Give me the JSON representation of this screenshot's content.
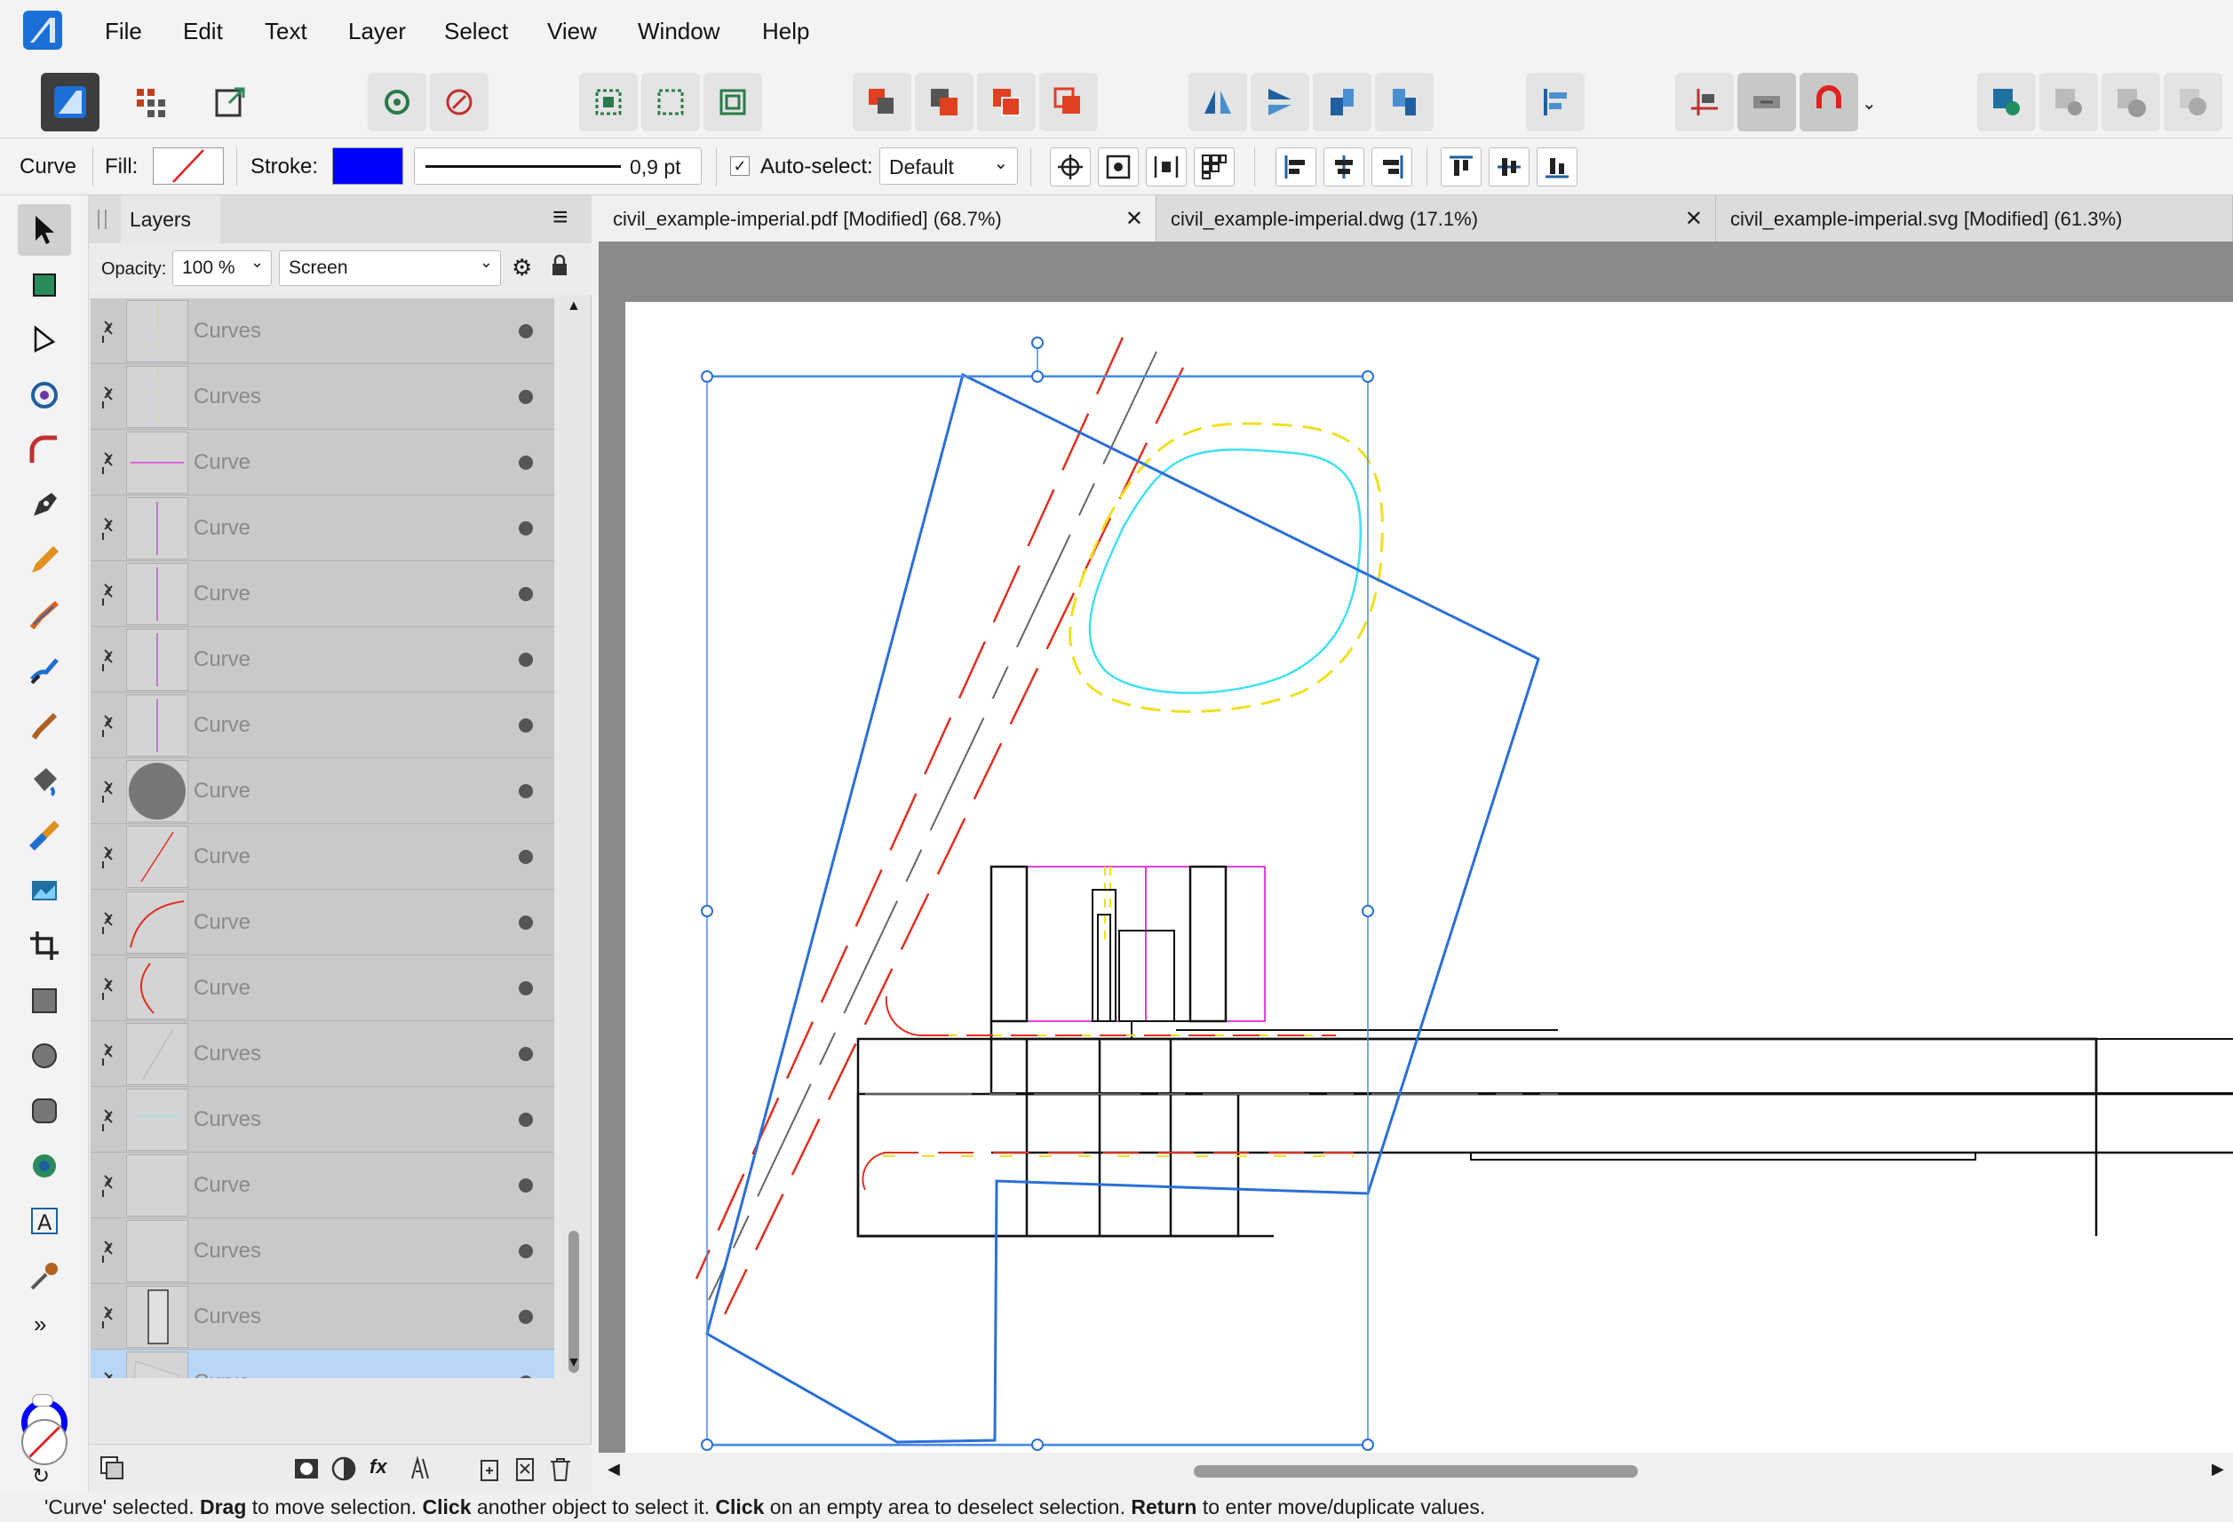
{
  "menu": [
    "File",
    "Edit",
    "Text",
    "Layer",
    "Select",
    "View",
    "Window",
    "Help"
  ],
  "context": {
    "object_type": "Curve",
    "fill_label": "Fill:",
    "stroke_label": "Stroke:",
    "stroke_color": "#0000ff",
    "stroke_width": "0,9 pt",
    "autoselect_label": "Auto-select:",
    "autoselect_value": "Default"
  },
  "layers_panel": {
    "title": "Layers",
    "opacity_label": "Opacity:",
    "opacity_value": "100 %",
    "blend_mode": "Screen",
    "rows": [
      {
        "name": "Curves",
        "thumb": "faint-v",
        "selected": false
      },
      {
        "name": "Curves",
        "thumb": "faint-v",
        "selected": false
      },
      {
        "name": "Curve",
        "thumb": "magenta-h",
        "selected": false
      },
      {
        "name": "Curve",
        "thumb": "purple-v",
        "selected": false
      },
      {
        "name": "Curve",
        "thumb": "purple-v",
        "selected": false
      },
      {
        "name": "Curve",
        "thumb": "purple-v",
        "selected": false
      },
      {
        "name": "Curve",
        "thumb": "purple-v",
        "selected": false
      },
      {
        "name": "Curve",
        "thumb": "gray-circle",
        "selected": false
      },
      {
        "name": "Curve",
        "thumb": "red-diagonal",
        "selected": false
      },
      {
        "name": "Curve",
        "thumb": "red-arc",
        "selected": false
      },
      {
        "name": "Curve",
        "thumb": "red-arc-left",
        "selected": false
      },
      {
        "name": "Curves",
        "thumb": "faint-diag",
        "selected": false
      },
      {
        "name": "Curves",
        "thumb": "faint-cyan",
        "selected": false
      },
      {
        "name": "Curve",
        "thumb": "blank",
        "selected": false
      },
      {
        "name": "Curves",
        "thumb": "blank",
        "selected": false
      },
      {
        "name": "Curves",
        "thumb": "rect",
        "selected": false
      },
      {
        "name": "Curve",
        "thumb": "poly",
        "selected": true
      }
    ]
  },
  "tabs": [
    {
      "label": "civil_example-imperial.pdf [Modified] (68.7%)",
      "active": true,
      "closable": true
    },
    {
      "label": "civil_example-imperial.dwg (17.1%)",
      "active": false,
      "closable": true
    },
    {
      "label": "civil_example-imperial.svg [Modified] (61.3%)",
      "active": false,
      "closable": false
    }
  ],
  "status": {
    "prefix": "'Curve' selected. ",
    "b1": "Drag",
    "t1": " to move selection. ",
    "b2": "Click",
    "t2": " another object to select it. ",
    "b3": "Click",
    "t3": " on an empty area to deselect selection. ",
    "b4": "Return",
    "t4": " to enter move/duplicate values."
  },
  "colors": {
    "selection_blue": "#2b6fd8",
    "red_line": "#e03020",
    "yellow_dash": "#f0e020",
    "cyan": "#40e0f0",
    "magenta": "#e040e0"
  }
}
